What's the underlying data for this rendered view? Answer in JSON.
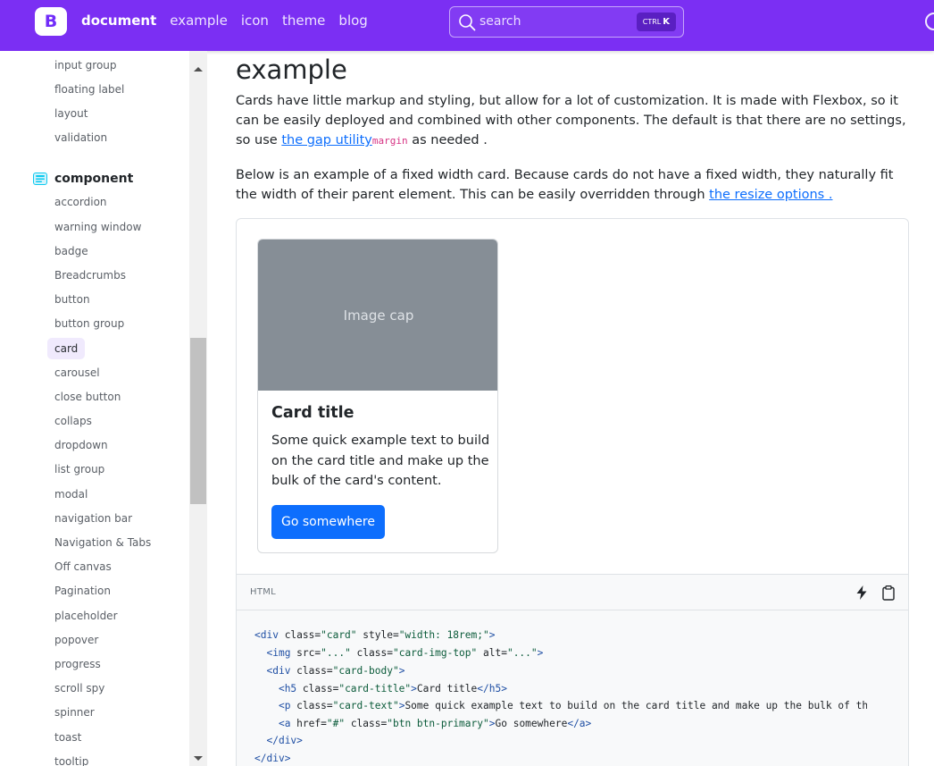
{
  "navbar": {
    "brand_letter": "B",
    "links": [
      "document",
      "example",
      "icon",
      "theme",
      "blog"
    ],
    "active_link": "document",
    "search_placeholder": "search",
    "search_kbd_ctrl": "CTRL",
    "search_kbd_key": "K",
    "bg_color": "#7b2ff3"
  },
  "sidebar": {
    "forms_items": [
      "input group",
      "floating label",
      "layout",
      "validation"
    ],
    "section_title": "component",
    "section_icon": "component-icon",
    "component_items": [
      "accordion",
      "warning window",
      "badge",
      "Breadcrumbs",
      "button",
      "button group",
      "card",
      "carousel",
      "close button",
      "collaps",
      "dropdown",
      "list group",
      "modal",
      "navigation bar",
      "Navigation & Tabs",
      "Off canvas",
      "Pagination",
      "placeholder",
      "popover",
      "progress",
      "scroll spy",
      "spinner",
      "toast",
      "tooltip"
    ],
    "active_item": "card"
  },
  "main": {
    "title": "example",
    "p1_text": "Cards have little markup and styling, but allow for a lot of customization. It is made with Flexbox, so it can be easily deployed and combined with other components. The default is that there are no settings, so use ",
    "p1_link": "the gap utility",
    "p1_code": "margin",
    "p1_tail": " as needed .",
    "p2_text": "Below is an example of a fixed width card. Because cards do not have a fixed width, they naturally fit the width of their parent element. This can be easily overridden through ",
    "p2_link": "the resize options ."
  },
  "card": {
    "image_cap": "Image cap",
    "title": "Card title",
    "text": "Some quick example text to build on the card title and make up the bulk of the card's content.",
    "button": "Go somewhere",
    "button_color": "#0d6efd"
  },
  "code": {
    "language": "HTML",
    "lines": [
      "<div class=\"card\" style=\"width: 18rem;\">",
      "  <img src=\"...\" class=\"card-img-top\" alt=\"...\">",
      "  <div class=\"card-body\">",
      "    <h5 class=\"card-title\">Card title</h5>",
      "    <p class=\"card-text\">Some quick example text to build on the card title and make up the bulk of the card's content.</p>",
      "    <a href=\"#\" class=\"btn btn-primary\">Go somewhere</a>",
      "  </div>",
      "</div>"
    ]
  }
}
